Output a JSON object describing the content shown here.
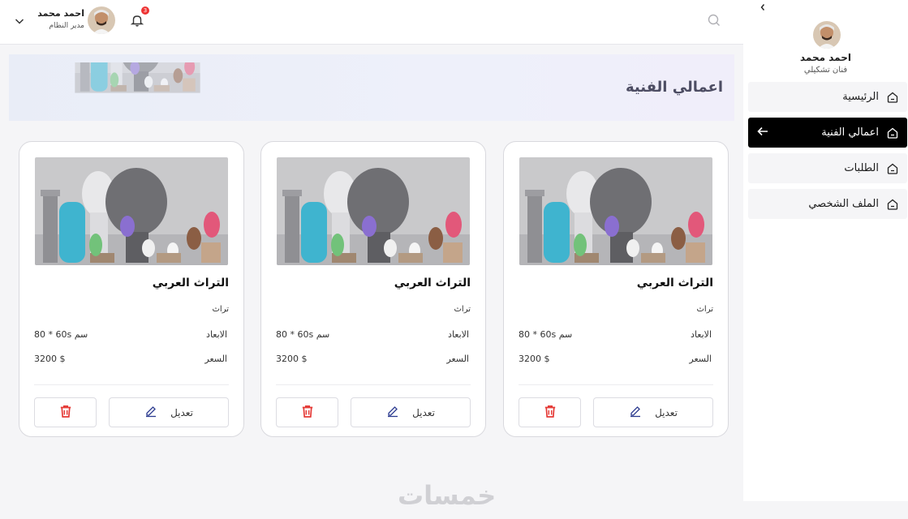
{
  "sidebar": {
    "collapse_icon": "chevron-left-icon",
    "user_name": "احمد محمد",
    "user_role": "فنان تشكيلي",
    "items": [
      {
        "label": "الرئيسية",
        "icon": "home-icon",
        "active": false
      },
      {
        "label": "اعمالي الفنية",
        "icon": "home-icon",
        "active": true
      },
      {
        "label": "الطلبات",
        "icon": "home-icon",
        "active": false
      },
      {
        "label": "الملف الشخصي",
        "icon": "home-icon",
        "active": false
      }
    ]
  },
  "header": {
    "user_name": "احمد محمد",
    "user_role": "مدير النظام",
    "notification_count": "3",
    "search_icon": "search-icon"
  },
  "banner": {
    "title": "اعمالي الفنية"
  },
  "cards": [
    {
      "title": "التراث العربي",
      "category": "تراث",
      "dims_label": "الابعاد",
      "dims_value": "80 * 60s سم",
      "price_label": "السعر",
      "price_value": "3200 $",
      "edit_label": "تعديل"
    },
    {
      "title": "التراث العربي",
      "category": "تراث",
      "dims_label": "الابعاد",
      "dims_value": "80 * 60s سم",
      "price_label": "السعر",
      "price_value": "3200 $",
      "edit_label": "تعديل"
    },
    {
      "title": "التراث العربي",
      "category": "تراث",
      "dims_label": "الابعاد",
      "dims_value": "80 * 60s سم",
      "price_label": "السعر",
      "price_value": "3200 $",
      "edit_label": "تعديل"
    }
  ],
  "footer": {
    "logo": "خمسات"
  },
  "colors": {
    "active_nav": "#000000",
    "badge": "#e33333",
    "delete": "#e53935",
    "banner_title": "#4d4d63"
  }
}
